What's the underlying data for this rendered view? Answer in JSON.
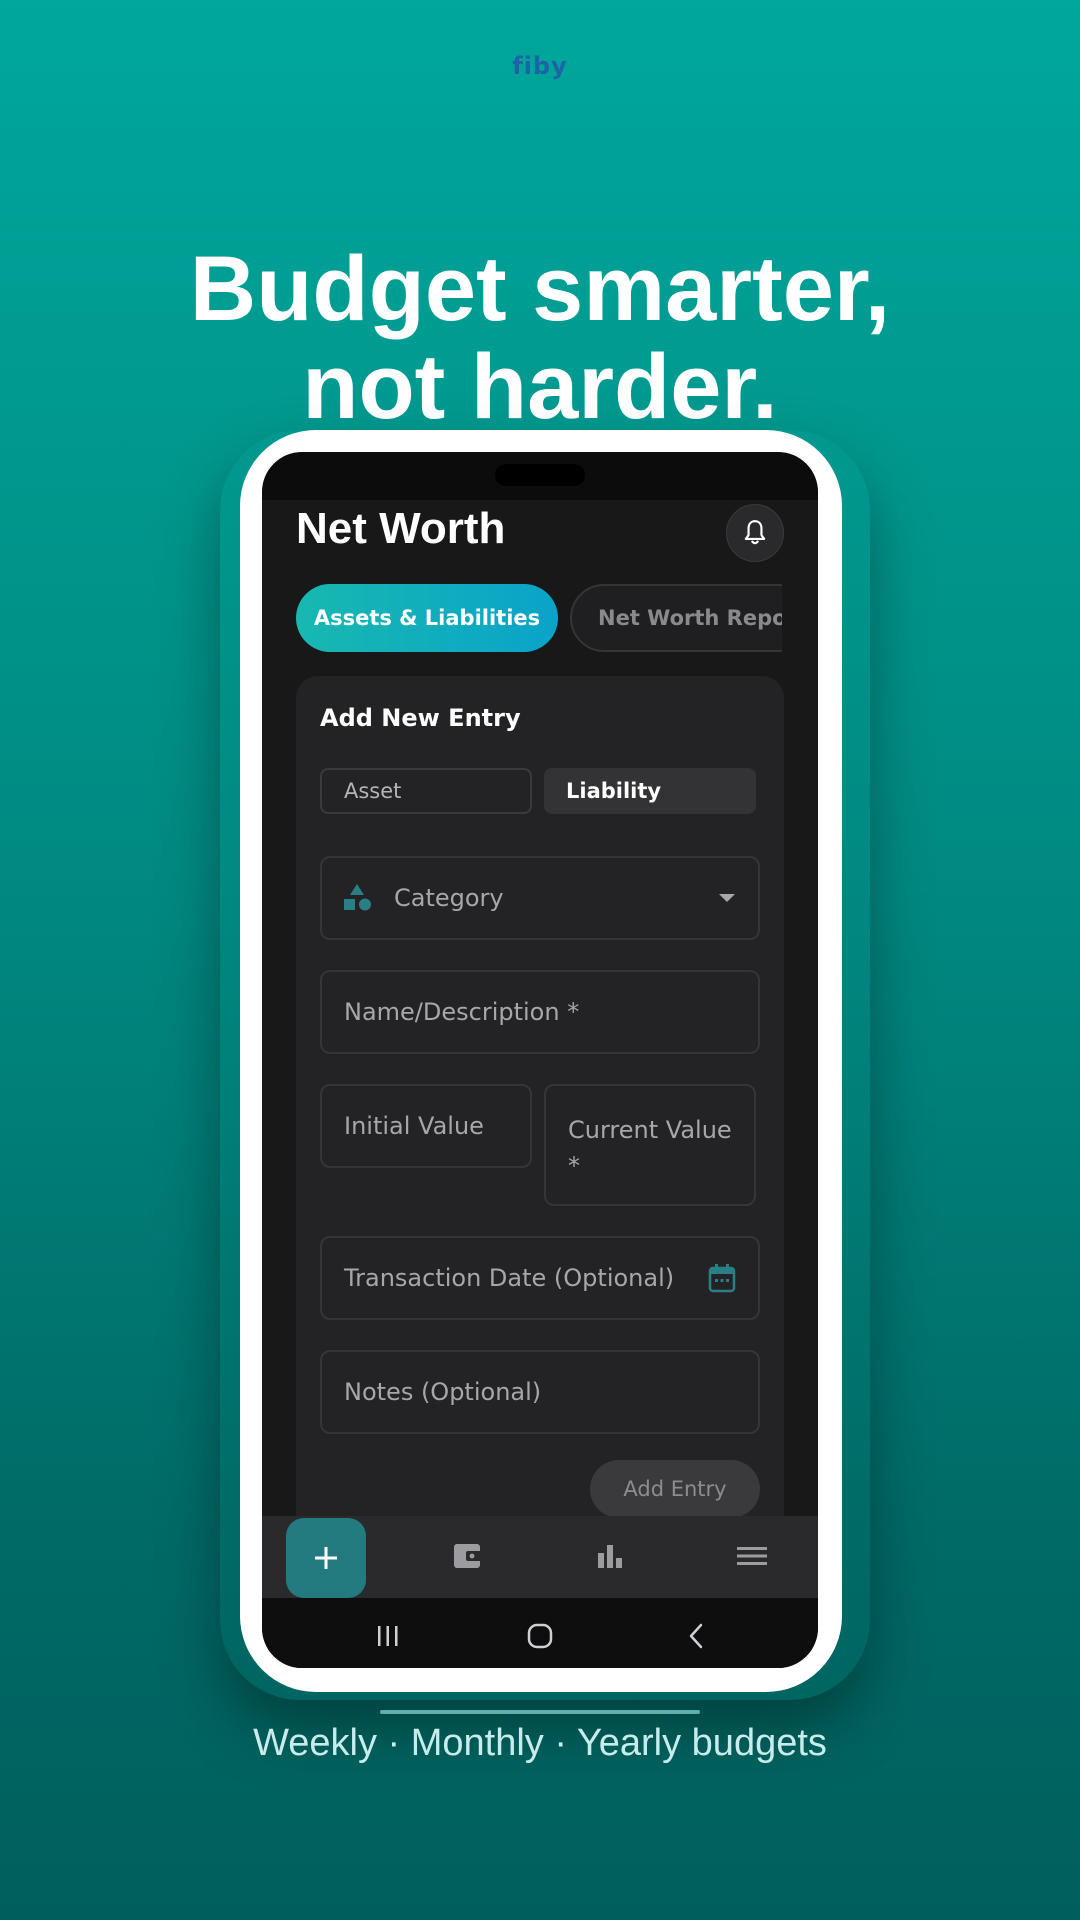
{
  "brand": {
    "name": "fiby"
  },
  "headline": {
    "line1": "Budget smarter,",
    "line2": "not harder."
  },
  "app": {
    "title": "Net Worth",
    "tabs": [
      {
        "label": "Assets & Liabilities",
        "active": true
      },
      {
        "label": "Net Worth Report",
        "active": false
      }
    ],
    "form": {
      "title": "Add New Entry",
      "type_options": [
        {
          "label": "Asset",
          "selected": false
        },
        {
          "label": "Liability",
          "selected": true
        }
      ],
      "category_placeholder": "Category",
      "name_placeholder": "Name/Description *",
      "initial_value_placeholder": "Initial Value",
      "current_value_placeholder": "Current Value *",
      "date_placeholder": "Transaction Date (Optional)",
      "notes_placeholder": "Notes (Optional)",
      "submit_label": "Add Entry"
    },
    "bottom_nav": {
      "fab_icon": "plus-icon",
      "items": [
        "wallet-icon",
        "bar-chart-icon",
        "menu-icon"
      ]
    },
    "system_nav": [
      "recent-apps-icon",
      "home-icon",
      "back-icon"
    ]
  },
  "tagline": "Weekly · Monthly · Yearly budgets",
  "colors": {
    "accent": "#237b80",
    "tab_gradient_start": "#18b8b0",
    "tab_gradient_end": "#0aa3c9",
    "background_top": "#00a79c",
    "background_bottom": "#005f5c"
  }
}
